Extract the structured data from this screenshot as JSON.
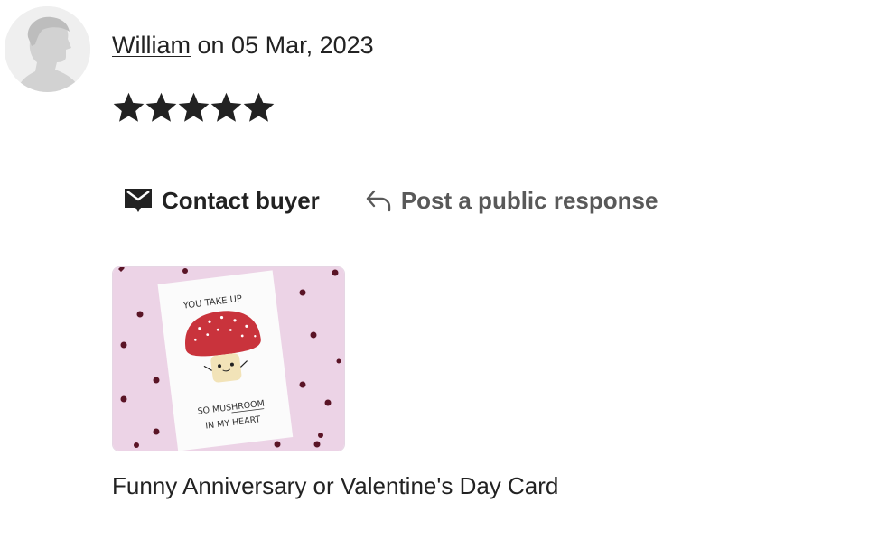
{
  "review": {
    "reviewer_name": "William",
    "date_text": "on 05 Mar, 2023",
    "rating": 5,
    "rating_max": 5
  },
  "actions": {
    "contact_label": "Contact buyer",
    "respond_label": "Post a public response"
  },
  "product": {
    "title": "Funny Anniversary or Valentine's Day Card",
    "card_text_top": "YOU TAKE UP",
    "card_text_bottom_1": "SO MUSHROOM",
    "card_text_bottom_2": "IN MY HEART"
  },
  "colors": {
    "text": "#222222",
    "muted": "#595959",
    "thumbnail_bg": "#ecd3e6",
    "mushroom_cap": "#c9333c"
  }
}
